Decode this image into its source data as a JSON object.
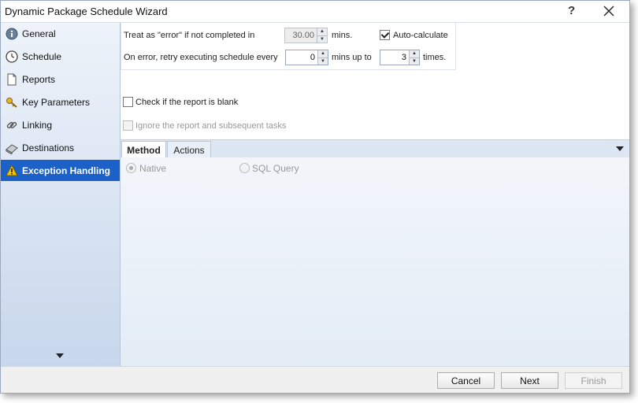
{
  "window": {
    "title": "Dynamic Package Schedule Wizard",
    "help_label": "?"
  },
  "sidebar": {
    "items": [
      {
        "label": "General",
        "icon": "info-icon"
      },
      {
        "label": "Schedule",
        "icon": "clock-icon"
      },
      {
        "label": "Reports",
        "icon": "document-icon"
      },
      {
        "label": "Key Parameters",
        "icon": "key-icon"
      },
      {
        "label": "Linking",
        "icon": "link-icon"
      },
      {
        "label": "Destinations",
        "icon": "destination-icon"
      },
      {
        "label": "Exception Handling",
        "icon": "warning-icon",
        "active": true
      }
    ]
  },
  "exception": {
    "treat_prefix": "Treat as \"error\" if not completed in",
    "timeout_value": "30.00",
    "mins_label": "mins.",
    "auto_calc_label": "Auto-calculate",
    "auto_calc_checked": true,
    "retry_prefix": "On error, retry  executing schedule every",
    "retry_every_value": "0",
    "mins_up_to_label": "mins up to",
    "retry_times_value": "3",
    "times_label": "times.",
    "check_blank_label": "Check if the report is blank",
    "ignore_label": "Ignore the report and subsequent tasks"
  },
  "tabs": [
    {
      "label": "Method",
      "active": true
    },
    {
      "label": "Actions"
    }
  ],
  "method": {
    "native_label": "Native",
    "sql_label": "SQL Query"
  },
  "footer": {
    "cancel_label": "Cancel",
    "next_label": "Next",
    "finish_label": "Finish"
  },
  "colors": {
    "accent": "#1c61c8",
    "warning": "#f5c400"
  }
}
